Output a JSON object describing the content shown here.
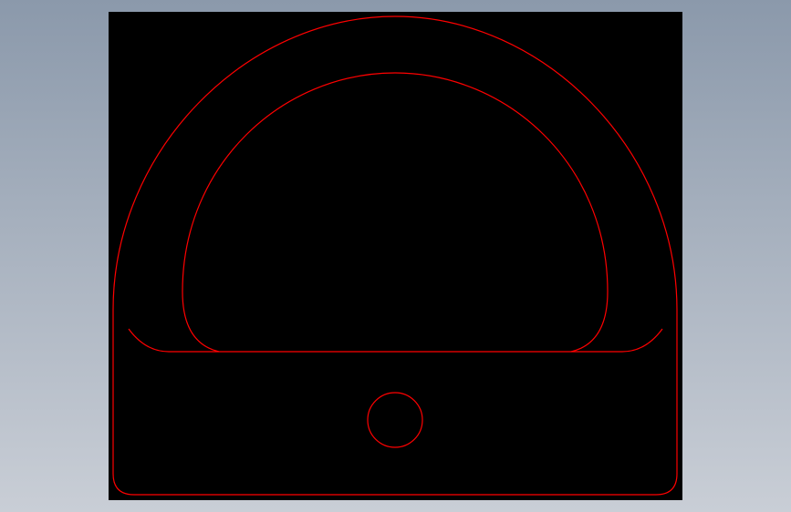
{
  "colors": {
    "background_top": "#8b99ab",
    "background_bottom": "#c9ced6",
    "viewport": "#000000",
    "line": "#ff0000"
  },
  "shapes": [
    "outer-profile",
    "inner-cutout",
    "base-line",
    "left-fillet",
    "right-fillet",
    "hole-circle"
  ]
}
